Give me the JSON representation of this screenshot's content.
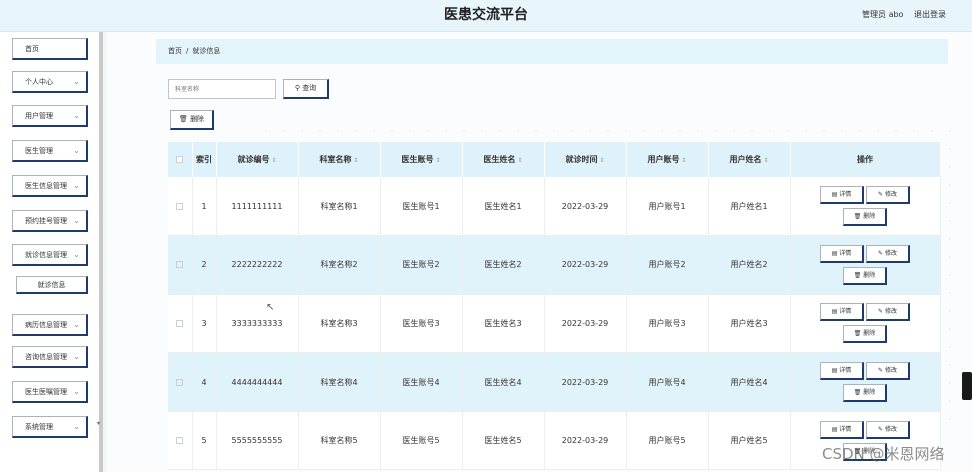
{
  "header": {
    "title": "医患交流平台",
    "admin_label": "管理员 abo",
    "logout": "退出登录"
  },
  "sidebar": {
    "items": [
      {
        "label": "首页",
        "has_chevron": false
      },
      {
        "label": "个人中心",
        "has_chevron": true
      },
      {
        "label": "用户管理",
        "has_chevron": true
      },
      {
        "label": "医生管理",
        "has_chevron": true
      },
      {
        "label": "医生信息管理",
        "has_chevron": true
      },
      {
        "label": "预约挂号管理",
        "has_chevron": true
      },
      {
        "label": "就诊信息管理",
        "has_chevron": true
      },
      {
        "label": "病历信息管理",
        "has_chevron": true
      },
      {
        "label": "咨询信息管理",
        "has_chevron": true
      },
      {
        "label": "医生医嘱管理",
        "has_chevron": true
      },
      {
        "label": "系统管理",
        "has_chevron": true
      }
    ],
    "sub_item": "就诊信息"
  },
  "breadcrumb": {
    "home": "首页",
    "separator": "/",
    "current": "就诊信息"
  },
  "search": {
    "placeholder": "科室名称",
    "button": "查询",
    "icon": "search-icon"
  },
  "toolbar": {
    "delete": "删除",
    "icon": "trash-icon"
  },
  "table": {
    "headers": [
      "索引",
      "就诊编号",
      "科室名称",
      "医生账号",
      "医生姓名",
      "就诊时间",
      "用户账号",
      "用户姓名",
      "操作"
    ],
    "rows": [
      {
        "index": "1",
        "code": "1111111111",
        "dept": "科室名称1",
        "doctor_account": "医生账号1",
        "doctor_name": "医生姓名1",
        "time": "2022-03-29",
        "user_account": "用户账号1",
        "user_name": "用户姓名1"
      },
      {
        "index": "2",
        "code": "2222222222",
        "dept": "科室名称2",
        "doctor_account": "医生账号2",
        "doctor_name": "医生姓名2",
        "time": "2022-03-29",
        "user_account": "用户账号2",
        "user_name": "用户姓名2"
      },
      {
        "index": "3",
        "code": "3333333333",
        "dept": "科室名称3",
        "doctor_account": "医生账号3",
        "doctor_name": "医生姓名3",
        "time": "2022-03-29",
        "user_account": "用户账号3",
        "user_name": "用户姓名3"
      },
      {
        "index": "4",
        "code": "4444444444",
        "dept": "科室名称4",
        "doctor_account": "医生账号4",
        "doctor_name": "医生姓名4",
        "time": "2022-03-29",
        "user_account": "用户账号4",
        "user_name": "用户姓名4"
      },
      {
        "index": "5",
        "code": "5555555555",
        "dept": "科室名称5",
        "doctor_account": "医生账号5",
        "doctor_name": "医生姓名5",
        "time": "2022-03-29",
        "user_account": "用户账号5",
        "user_name": "用户姓名5"
      }
    ],
    "actions": {
      "detail": "详情",
      "edit": "修改",
      "delete": "删除"
    }
  },
  "watermark": "CSDN @米恩网络",
  "colors": {
    "header_bg": "#e8f6fc",
    "row_alt_bg": "#e0f3fb",
    "button_border": "#1f3b6e"
  }
}
